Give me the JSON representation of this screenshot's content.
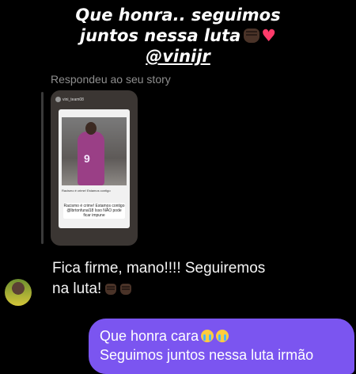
{
  "caption": {
    "line1": "Que honra.. seguimos",
    "line2": "juntos nessa luta",
    "handle": "@vinijr",
    "heart": "♥"
  },
  "replied_label": "Respondeu ao seu story",
  "story": {
    "username": "vini_team08",
    "post_text": "Racismo é crime! Estamos contigo",
    "sticker": "Racismo é crime! Estamos contigo @lbrtonfunal18 Isso NÃO pode ficar impune",
    "jersey_number": "9"
  },
  "messages": [
    {
      "text_line1": "Fica firme, mano!!!! Seguiremos",
      "text_line2": "na luta!"
    },
    {
      "text_line1": "Que honra cara",
      "text_line2": "Seguimos juntos nessa luta irmão"
    }
  ],
  "colors": {
    "sent_bubble": "#7b55f0",
    "background": "#000000"
  }
}
